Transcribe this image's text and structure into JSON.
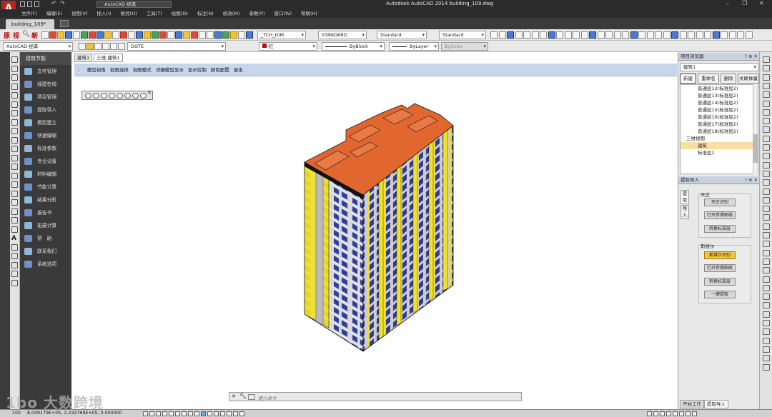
{
  "app": {
    "window_title": "Autodesk AutoCAD 2014    building_109.dwg",
    "logo_glyph": "A",
    "workspace": "AutoCAD 经典"
  },
  "menu": [
    "文件(F)",
    "编辑(E)",
    "视图(V)",
    "插入(I)",
    "格式(O)",
    "工具(T)",
    "绘图(D)",
    "标注(N)",
    "修改(M)",
    "参数(P)",
    "窗口(W)",
    "帮助(H)"
  ],
  "file_tab": "building_109*",
  "toolbar": {
    "row1_left_labels": [
      "原",
      "视",
      "新"
    ],
    "text_style": "_TCH_DIM",
    "dim_style": "STANDARD",
    "table_style": "Standard",
    "multileader_style": "Standard"
  },
  "toolbar2": {
    "workspace": "AutoCAD 经典",
    "layer": "DOTE",
    "color": "红",
    "linetype": "ByBlock",
    "lineweight": "ByLayer",
    "plotstyle": "ByColor"
  },
  "nav": {
    "header": "建筑节能",
    "items": [
      "文件管理",
      "绿建在线",
      "项目管理",
      "提取导入",
      "模型建立",
      "快速编辑",
      "标准参数",
      "专业设置",
      "材料编辑",
      "节能计算",
      "结果分析",
      "报告书",
      "拓展计算",
      "帮　助",
      "联系我们",
      "系统选项"
    ]
  },
  "doc_tabs": [
    "建筑1",
    "三维-建筑1"
  ],
  "view_toolbar": [
    "模型视角",
    "视角选择",
    "视图模式",
    "详细模型显示",
    "显示控制",
    "颜色配置",
    "退出"
  ],
  "project_browser": {
    "title": "项目浏览器",
    "selector": "建筑1",
    "buttons": [
      "新建",
      "重命名",
      "删除",
      "关联体量"
    ],
    "tree": [
      {
        "label": "普通层12(标准层2)",
        "kind": "floor"
      },
      {
        "label": "普通层13(标准层2)",
        "kind": "floor"
      },
      {
        "label": "普通层14(标准层2)",
        "kind": "floor"
      },
      {
        "label": "普通层15(标准层2)",
        "kind": "floor"
      },
      {
        "label": "普通层16(标准层2)",
        "kind": "floor"
      },
      {
        "label": "普通层17(标准层2)",
        "kind": "floor"
      },
      {
        "label": "普通层18(标准层2)",
        "kind": "floor"
      },
      {
        "label": "三维视图",
        "kind": "section"
      },
      {
        "label": "建筑",
        "kind": "selected"
      },
      {
        "label": "标准层1",
        "kind": "floor"
      }
    ]
  },
  "extract_panel": {
    "title": "提取导入",
    "vtabs": [
      "提取",
      "导入"
    ],
    "group1_title": "天正",
    "group1_buttons": [
      "天正识别",
      "打开参照图纸",
      "转换标准层"
    ],
    "group2_title": "斯维尔",
    "group2_buttons": [
      "斯维尔识别",
      "打开参照图纸",
      "转换标准层",
      "一键提取"
    ],
    "bottom_tabs": [
      "开始工作",
      "提取导入"
    ]
  },
  "command_line": {
    "placeholder": "键入命令"
  },
  "status": {
    "coords": "8.049179E+05, 2.232769E+05, 0.000000",
    "zoom": "100"
  },
  "watermark": "1bo 大数跨境",
  "colors": {
    "roof": "#e2672f",
    "facade_yellow": "#f1e222",
    "facade_gray": "#d9d6d9",
    "window_blue": "#2d3f9a",
    "panel_head": "#c8d2e1",
    "highlight_button": "#f4c542"
  }
}
